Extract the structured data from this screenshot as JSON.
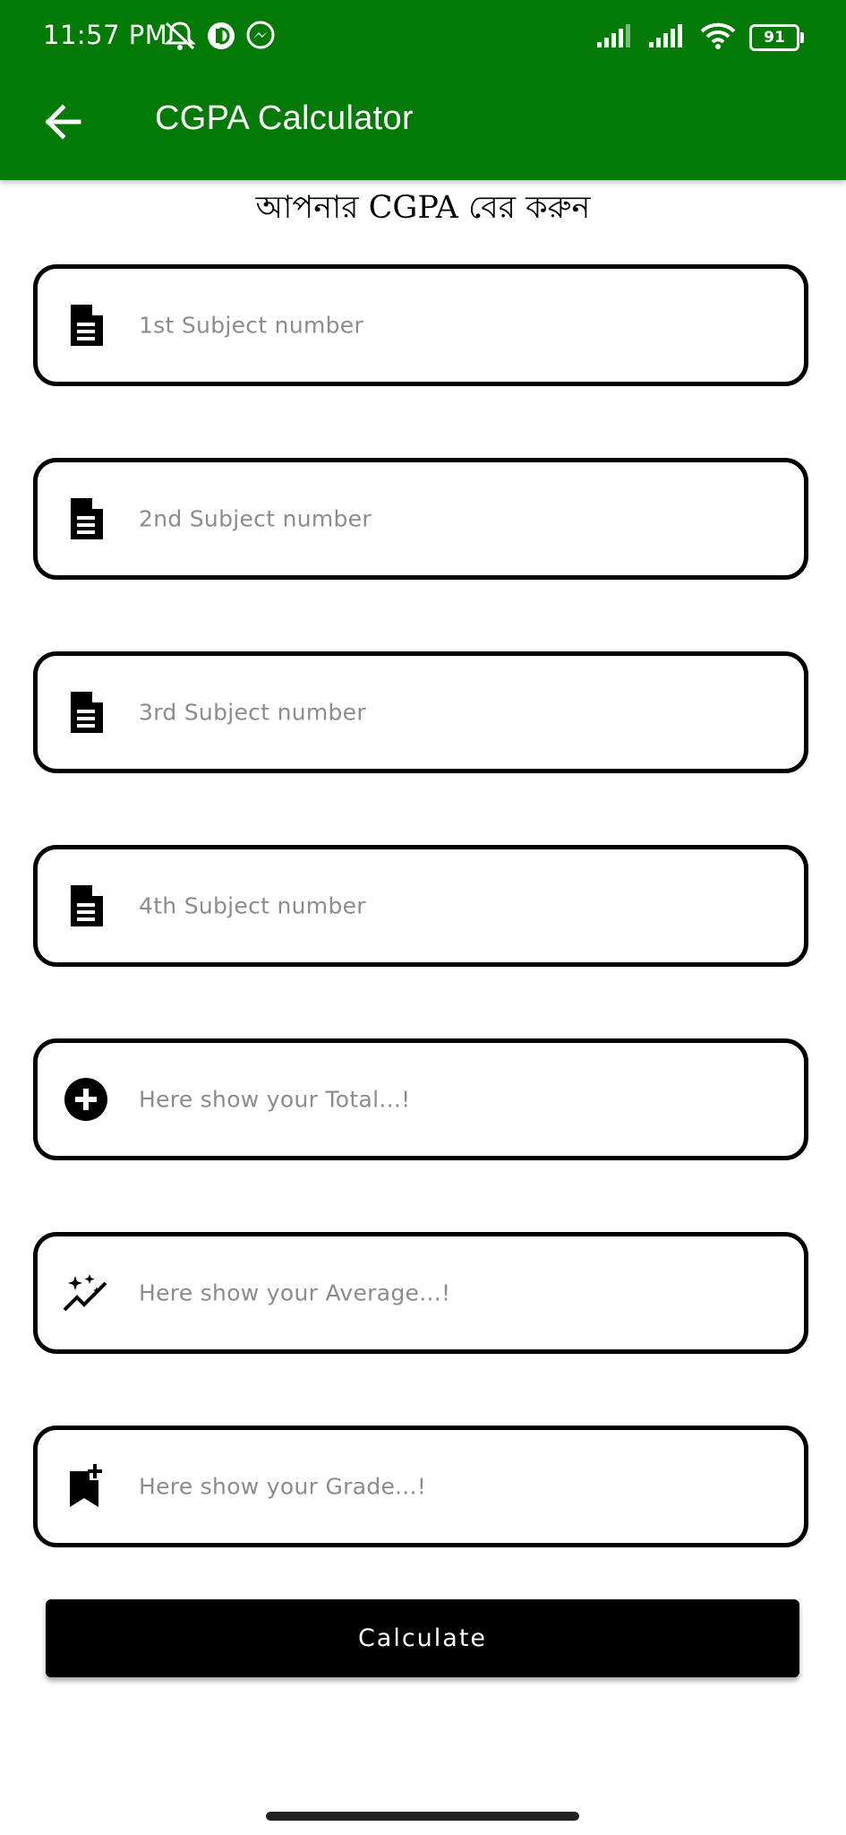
{
  "status_bar": {
    "time": "11:57 PM",
    "battery": "91",
    "icons": [
      "notifications-off-icon",
      "app-notification-icon",
      "messenger-icon",
      "signal-icon",
      "signal-icon",
      "wifi-icon",
      "battery-icon"
    ]
  },
  "toolbar": {
    "back_icon": "arrow-back-icon",
    "title": "CGPA Calculator",
    "background": "#027a05"
  },
  "heading": "আপনার CGPA বের করুন",
  "fields": [
    {
      "icon": "document-icon",
      "placeholder": "1st Subject number",
      "value": ""
    },
    {
      "icon": "document-icon",
      "placeholder": "2nd Subject number",
      "value": ""
    },
    {
      "icon": "document-icon",
      "placeholder": "3rd Subject number",
      "value": ""
    },
    {
      "icon": "document-icon",
      "placeholder": "4th Subject number",
      "value": ""
    },
    {
      "icon": "add-circle-icon",
      "placeholder": "Here show your Total...!",
      "value": ""
    },
    {
      "icon": "sparkle-chart-icon",
      "placeholder": "Here show your Average...!",
      "value": ""
    },
    {
      "icon": "bookmark-add-icon",
      "placeholder": "Here show your Grade...!",
      "value": ""
    }
  ],
  "calculate_label": "Calculate"
}
